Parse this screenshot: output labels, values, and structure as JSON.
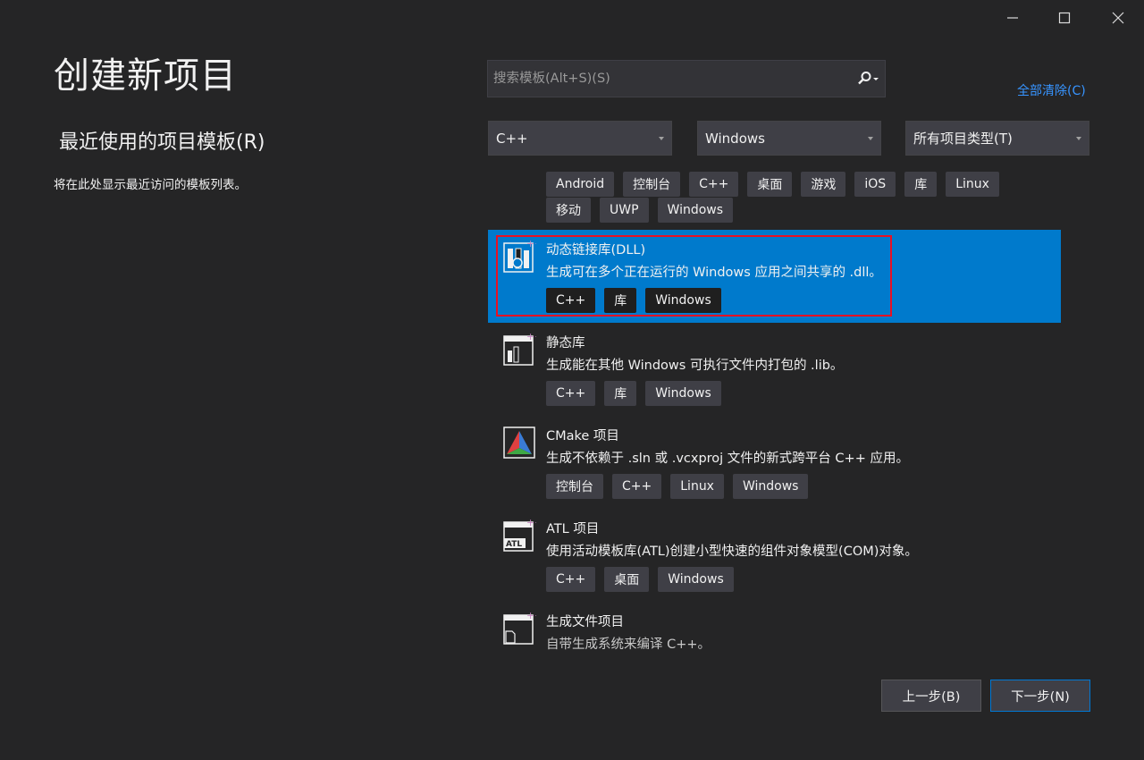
{
  "window_controls": {
    "minimize": "—",
    "maximize": "☐",
    "close": "✕"
  },
  "page_title": "创建新项目",
  "recent": {
    "title": "最近使用的项目模板(R)",
    "description": "将在此处显示最近访问的模板列表。"
  },
  "search": {
    "placeholder": "搜索模板(Alt+S)(S)",
    "value": ""
  },
  "clear_all": "全部清除(C)",
  "filters": {
    "language": "C++",
    "platform": "Windows",
    "project_type": "所有项目类型(T)"
  },
  "top_tags": {
    "row1": [
      "Android",
      "控制台",
      "C++",
      "桌面",
      "游戏",
      "iOS",
      "库",
      "Linux"
    ],
    "row2": [
      "移动",
      "UWP",
      "Windows"
    ]
  },
  "templates": [
    {
      "name": "动态链接库(DLL)",
      "description": "生成可在多个正在运行的 Windows 应用之间共享的 .dll。",
      "tags": [
        "C++",
        "库",
        "Windows"
      ],
      "icon": "dll-icon",
      "selected": true
    },
    {
      "name": "静态库",
      "description": "生成能在其他 Windows 可执行文件内打包的 .lib。",
      "tags": [
        "C++",
        "库",
        "Windows"
      ],
      "icon": "static-lib-icon",
      "selected": false
    },
    {
      "name": "CMake 项目",
      "description": "生成不依赖于 .sln 或 .vcxproj 文件的新式跨平台 C++ 应用。",
      "tags": [
        "控制台",
        "C++",
        "Linux",
        "Windows"
      ],
      "icon": "cmake-icon",
      "selected": false
    },
    {
      "name": "ATL 项目",
      "description": "使用活动模板库(ATL)创建小型快速的组件对象模型(COM)对象。",
      "tags": [
        "C++",
        "桌面",
        "Windows"
      ],
      "icon": "atl-icon",
      "selected": false
    },
    {
      "name": "生成文件项目",
      "description": "自带生成系统来编译 C++。",
      "tags": [],
      "icon": "makefile-icon",
      "selected": false
    }
  ],
  "buttons": {
    "back": "上一步(B)",
    "next": "下一步(N)"
  },
  "colors": {
    "background": "#252526",
    "selection": "#007acc",
    "link": "#3794ff",
    "focus_border": "#e81123"
  }
}
